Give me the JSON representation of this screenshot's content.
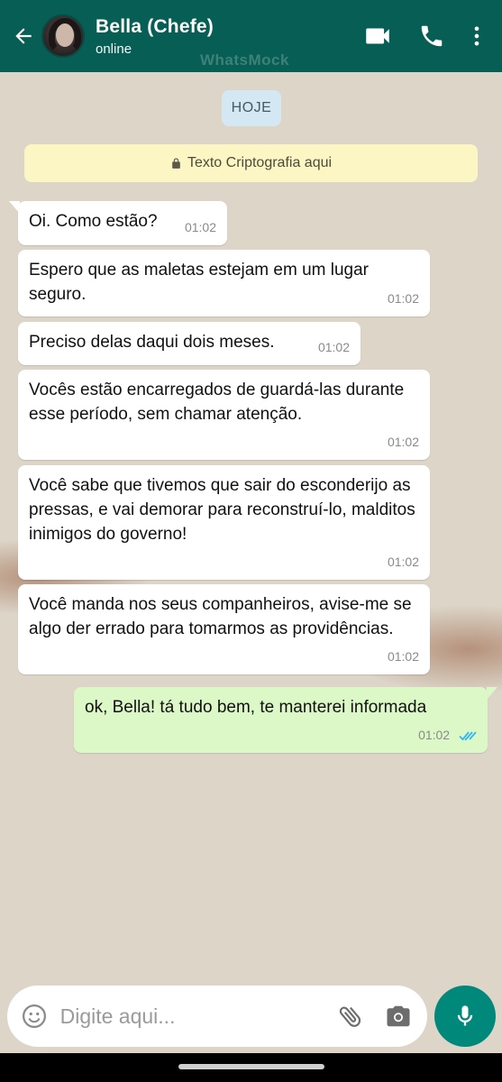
{
  "header": {
    "contact_name": "Bella (Chefe)",
    "contact_status": "online",
    "watermark": "WhatsMock",
    "bg_color": "#075e54",
    "icons": [
      "back-arrow-icon",
      "video-call-icon",
      "phone-icon",
      "more-options-icon"
    ]
  },
  "chat": {
    "date_chip": "HOJE",
    "encryption_note": "Texto Criptografia aqui",
    "messages": [
      {
        "direction": "in",
        "text": "Oi. Como estão?",
        "time": "01:02"
      },
      {
        "direction": "in",
        "text": "Espero que as maletas estejam em um lugar seguro.",
        "time": "01:02"
      },
      {
        "direction": "in",
        "text": "Preciso delas daqui dois meses.",
        "time": "01:02"
      },
      {
        "direction": "in",
        "text": "Vocês estão encarregados de guardá-las durante esse período, sem chamar atenção.",
        "time": "01:02"
      },
      {
        "direction": "in",
        "text": "Você sabe que tivemos que sair do esconderijo as pressas, e vai demorar para reconstruí-lo, malditos inimigos do governo!",
        "time": "01:02"
      },
      {
        "direction": "in",
        "text": "Você manda nos seus companheiros, avise-me se algo der errado para tomarmos as providências.",
        "time": "01:02"
      },
      {
        "direction": "out",
        "text": "ok, Bella! tá tudo bem, te manterei informada",
        "time": "01:02",
        "status": "read"
      }
    ]
  },
  "input": {
    "placeholder": "Digite aqui...",
    "value": "",
    "icons": [
      "emoji-icon",
      "attach-icon",
      "camera-icon",
      "mic-icon"
    ]
  },
  "colors": {
    "incoming_bubble": "#ffffff",
    "outgoing_bubble": "#dcf8c6",
    "read_ticks": "#34b7f1",
    "mic_button": "#00897b"
  }
}
